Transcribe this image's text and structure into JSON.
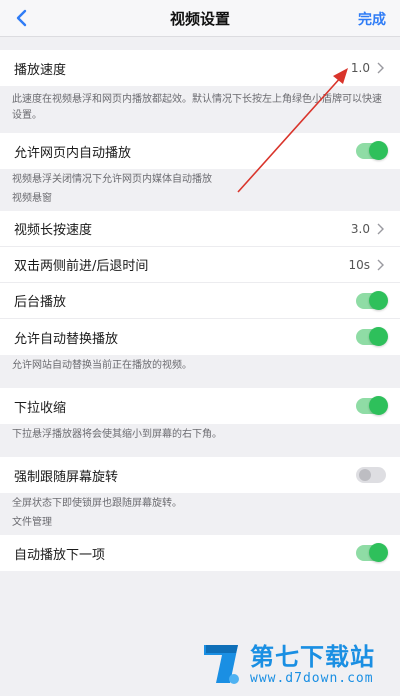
{
  "navbar": {
    "title": "视频设置",
    "done_label": "完成"
  },
  "playback_speed": {
    "label": "播放速度",
    "value": "1.0",
    "note": "此速度在视频悬浮和网页内播放都起效。默认情况下长按左上角绿色小盾牌可以快速设置。"
  },
  "inline_autoplay": {
    "label": "允许网页内自动播放",
    "enabled": true,
    "note": "视频悬浮关闭情况下允许网页内媒体自动播放"
  },
  "floating_section": {
    "title": "视频悬窗",
    "long_press_speed": {
      "label": "视频长按速度",
      "value": "3.0"
    },
    "double_tap_seek": {
      "label": "双击两侧前进/后退时间",
      "value": "10s"
    },
    "background_play": {
      "label": "后台播放",
      "enabled": true
    },
    "auto_switch": {
      "label": "允许自动替换播放",
      "enabled": true,
      "note": "允许网站自动替换当前正在播放的视频。"
    }
  },
  "pull_down_shrink": {
    "label": "下拉收缩",
    "enabled": true,
    "note": "下拉悬浮播放器将会使其缩小到屏幕的右下角。"
  },
  "force_rotate": {
    "label": "强制跟随屏幕旋转",
    "enabled": false,
    "note": "全屏状态下即使锁屏也跟随屏幕旋转。"
  },
  "file_section": {
    "title": "文件管理",
    "autoplay_next": {
      "label": "自动播放下一项",
      "enabled": true
    }
  },
  "watermark": {
    "title": "第七下载站",
    "url": "www.d7down.com"
  },
  "colors": {
    "accent": "#2f7cf6",
    "toggle_on": "#2ec05b",
    "annotation_arrow": "#d9342b",
    "watermark": "#1a8fe3"
  }
}
